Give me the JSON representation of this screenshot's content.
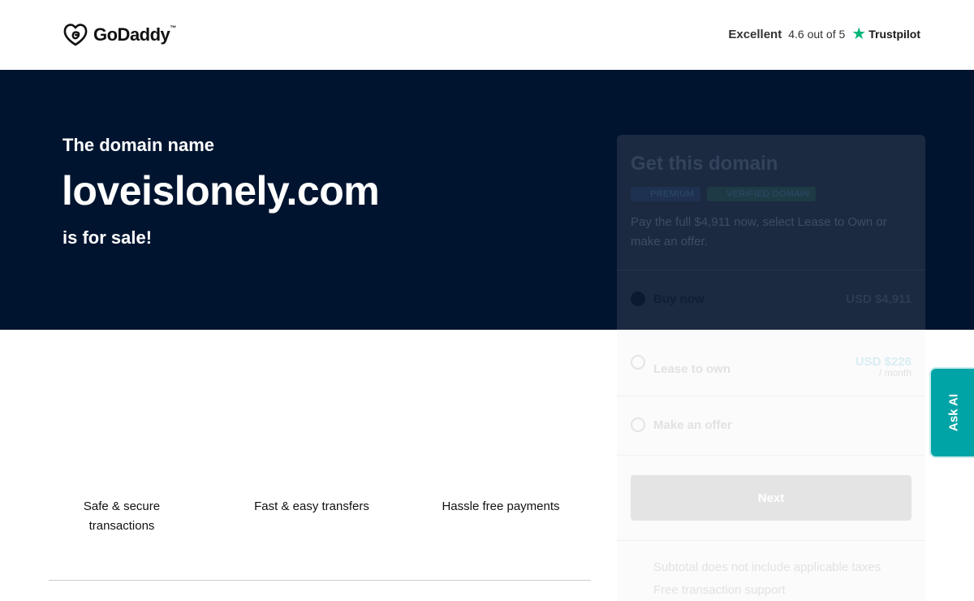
{
  "header": {
    "logo_text": "GoDaddy",
    "logo_tm": "™",
    "trust_rating_label": "Excellent",
    "trust_score": "4.6 out of 5",
    "trust_brand": "Trustpilot",
    "trust_star_icon": "star-icon"
  },
  "hero": {
    "pre_text": "The domain name",
    "domain": "loveislonely.com",
    "post_text": "is for sale!",
    "background_color": "#001430"
  },
  "features": [
    "Safe & secure transactions",
    "Fast & easy transfers",
    "Hassle free payments"
  ],
  "card": {
    "title": "Get this domain",
    "badges": [
      "PREMIUM",
      "VERIFIED DOMAIN"
    ],
    "description": "Pay the full $4,911 now, select Lease to Own or make an offer.",
    "options": [
      {
        "label": "Buy now",
        "price": "USD $4,911",
        "selected": true
      },
      {
        "label": "Lease to own",
        "price": "USD $226",
        "sub": "/ month",
        "selected": false
      },
      {
        "label": "Make an offer",
        "selected": false
      }
    ],
    "next_label": "Next",
    "notes": [
      "Subtotal does not include applicable taxes",
      "Free transaction support"
    ]
  },
  "ask_ai": {
    "label": "Ask AI",
    "color": "#00a4a6"
  }
}
